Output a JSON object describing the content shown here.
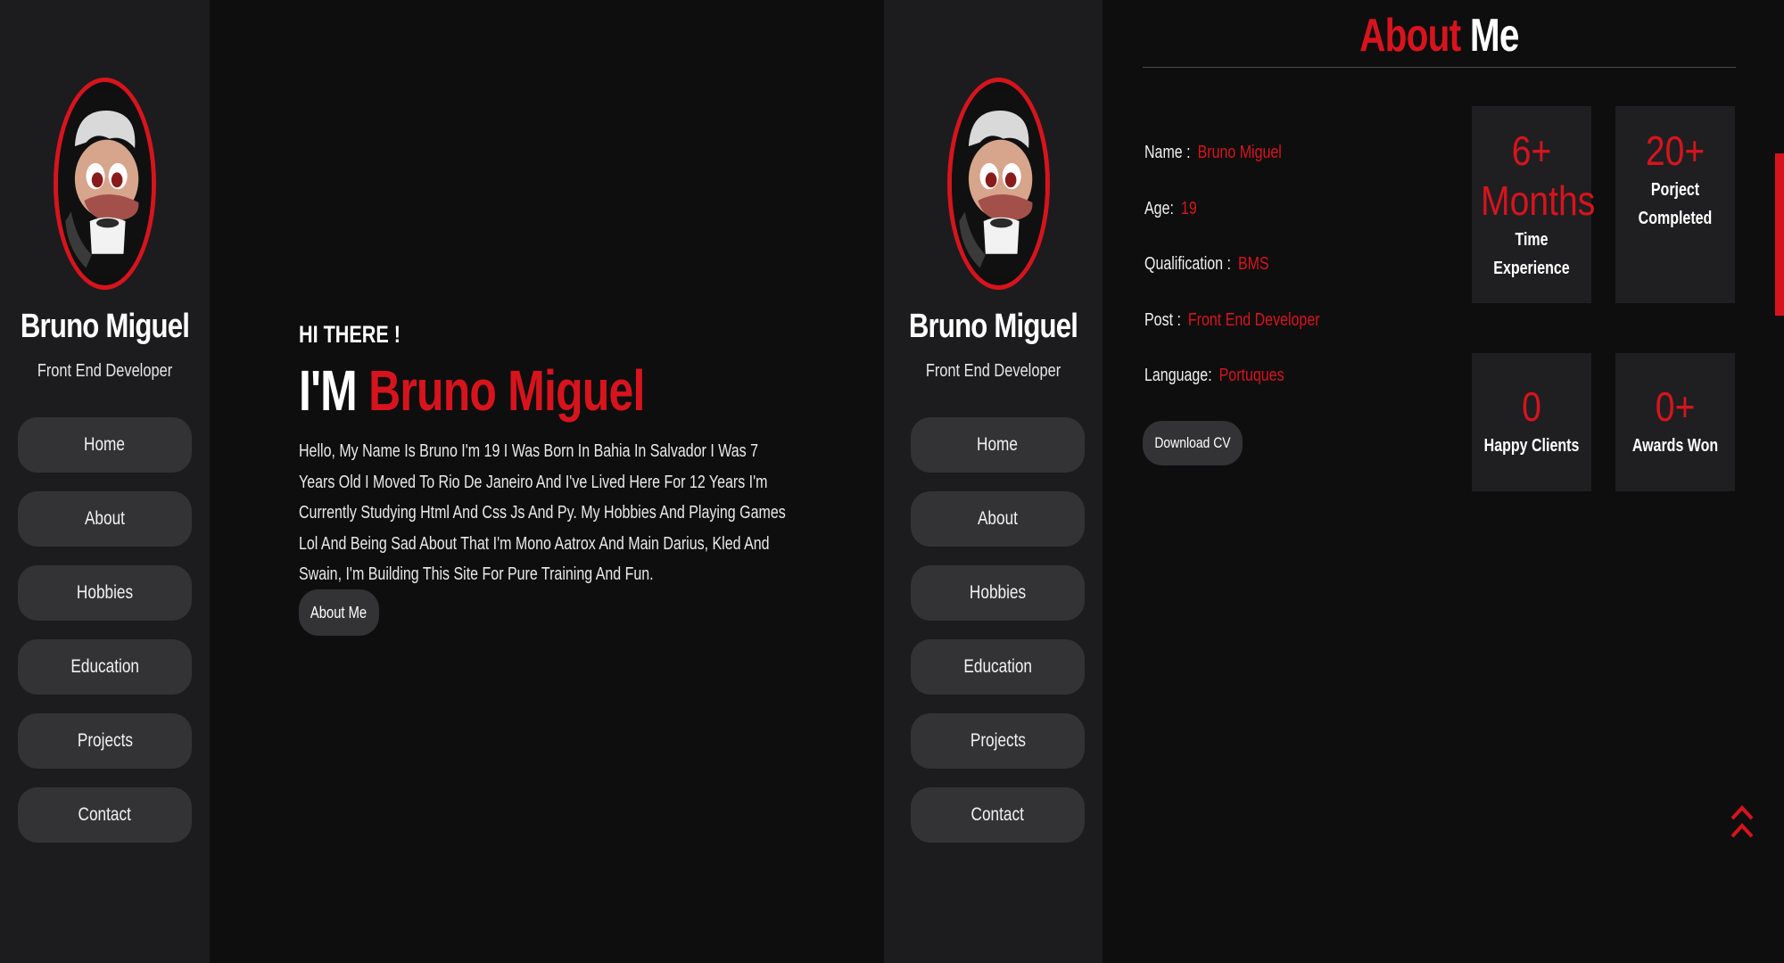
{
  "profile": {
    "name": "Bruno Miguel",
    "role": "Front End Developer"
  },
  "nav": {
    "items": [
      "Home",
      "About",
      "Hobbies",
      "Education",
      "Projects",
      "Contact"
    ]
  },
  "hero": {
    "greeting": "HI THERE !",
    "title_prefix": "I'M",
    "title_name": "Bruno Miguel",
    "text": "Hello, My Name Is Bruno I'm 19 I Was Born In Bahia In Salvador I Was 7 Years Old I Moved To Rio De Janeiro And I've Lived Here For 12 Years I'm Currently Studying Html And Css Js And Py. My Hobbies And Playing Games Lol And Being Sad About That I'm Mono Aatrox And Main Darius, Kled And Swain, I'm Building This Site For Pure Training And Fun.",
    "button": "About Me"
  },
  "about": {
    "title_accent": "About",
    "title_rest": "Me",
    "info": [
      {
        "label": "Name :",
        "value": "Bruno Miguel"
      },
      {
        "label": "Age:",
        "value": "19"
      },
      {
        "label": "Qualification :",
        "value": "BMS"
      },
      {
        "label": "Post :",
        "value": "Front End Developer"
      },
      {
        "label": "Language:",
        "value": "Portuques"
      }
    ],
    "download_button": "Download CV",
    "stats": {
      "experience": {
        "num": "6+",
        "num2": "Months",
        "label": "Time Experience"
      },
      "projects": {
        "num": "20+",
        "label1": "Porject",
        "label2": "Completed"
      },
      "clients": {
        "num": "0",
        "label": "Happy Clients"
      },
      "awards": {
        "num": "0+",
        "label": "Awards Won"
      }
    }
  },
  "colors": {
    "accent": "#d7141d",
    "background": "#0e0e0e",
    "sidebar": "#1c1c1e",
    "button": "#333336"
  },
  "icons": {
    "scroll_top": "double-chevron-up-icon",
    "avatar": "cartoon-avatar"
  }
}
